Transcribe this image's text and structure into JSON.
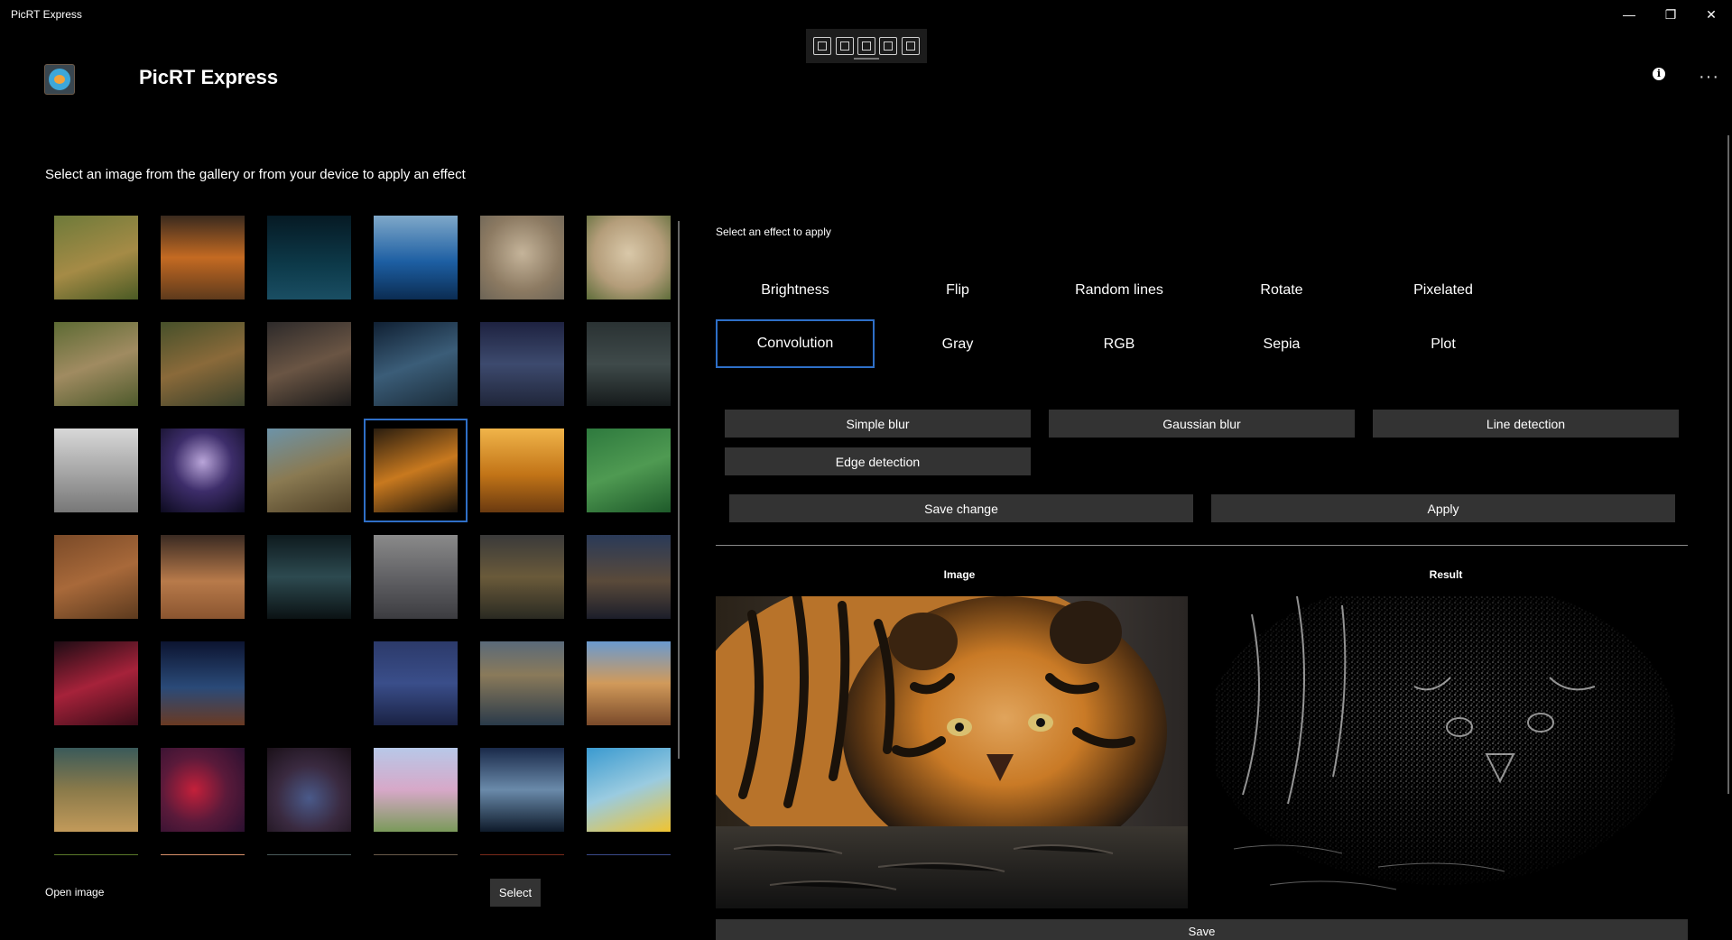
{
  "window": {
    "title": "PicRT Express",
    "controls": {
      "minimize": "—",
      "maximize": "❐",
      "close": "✕"
    }
  },
  "header": {
    "app_name": "PicRT Express",
    "logo_icon": "app-logo-icon",
    "info_icon": "i",
    "more_icon": "···"
  },
  "instruction": "Select an image from the gallery or from your device to apply an effect",
  "gallery": {
    "images": [
      "corgi-dog",
      "cave-sunset",
      "starry-rock",
      "blue-glacier",
      "tabby-cat",
      "lop-rabbit",
      "rabbit-grass",
      "tiger-rocks",
      "abandoned-room",
      "blue-train-car",
      "tent-night",
      "dark-sea-rocks",
      "gray-cats",
      "galaxy-planet",
      "owl-branch",
      "tiger-face",
      "golden-valley",
      "green-circuit",
      "steel-bolt",
      "mars-rover",
      "tunnel-rails",
      "foggy-pier",
      "desert-tower",
      "steel-bridge",
      "neon-sign",
      "mountain-night",
      "dark-sky",
      "blue-mountains",
      "stormy-sea",
      "canyon-sunset",
      "desert-dunes",
      "berries",
      "cave-arch",
      "pink-flowers",
      "winter-lake",
      "yellow-bird"
    ],
    "selected_index": 15
  },
  "open_image_label": "Open image",
  "select_button": "Select",
  "effects": {
    "label": "Select an effect to apply",
    "tabs": [
      "Brightness",
      "Flip",
      "Random lines",
      "Rotate",
      "Pixelated",
      "Convolution",
      "Gray",
      "RGB",
      "Sepia",
      "Plot"
    ],
    "active": "Convolution"
  },
  "convolution_options": [
    "Simple blur",
    "Gaussian blur",
    "Line detection",
    "Edge detection"
  ],
  "save_change_button": "Save change",
  "apply_button": "Apply",
  "preview": {
    "image_caption": "Image",
    "result_caption": "Result"
  },
  "save_button": "Save"
}
